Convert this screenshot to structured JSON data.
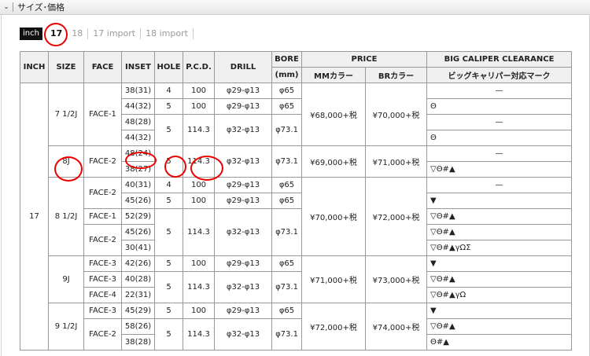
{
  "section": {
    "title": "サイズ･価格"
  },
  "tabs": [
    {
      "label": "inch"
    },
    {
      "label": "17"
    },
    {
      "label": "18"
    },
    {
      "label": "17 import"
    },
    {
      "label": "18 import"
    }
  ],
  "table": {
    "headers": {
      "inch": "INCH",
      "size": "SIZE",
      "face": "FACE",
      "inset": "INSET",
      "hole": "HOLE",
      "pcd": "P.C.D.",
      "drill": "DRILL",
      "bore": "BORE",
      "bore_unit": "(mm)",
      "price": "PRICE",
      "mm_color": "MMカラー",
      "br_color": "BRカラー",
      "clearance": "BIG CALIPER CLEARANCE",
      "clearance_sub": "ビッグキャリパー対応マーク"
    },
    "inch": "17",
    "groups": [
      {
        "size": "7 1/2J",
        "mm": "¥68,000+税",
        "br": "¥70,000+税"
      },
      {
        "size": "8J",
        "mm": "¥69,000+税",
        "br": "¥71,000+税"
      },
      {
        "size": "8 1/2J",
        "mm": "¥70,000+税",
        "br": "¥72,000+税"
      },
      {
        "size": "9J",
        "mm": "¥71,000+税",
        "br": "¥73,000+税"
      },
      {
        "size": "9 1/2J",
        "mm": "¥72,000+税",
        "br": "¥74,000+税"
      }
    ],
    "rows": [
      {
        "inset": "38(31)",
        "clearance": "—"
      },
      {
        "inset": "44(32)",
        "clearance": "Θ"
      },
      {
        "inset": "48(28)",
        "clearance": "—"
      },
      {
        "inset": "44(32)",
        "clearance": "Θ"
      },
      {
        "inset": "48(24)",
        "clearance": "—"
      },
      {
        "inset": "38(27)",
        "clearance": "▽Θ#▲"
      },
      {
        "inset": "40(31)",
        "clearance": "—"
      },
      {
        "inset": "45(26)",
        "clearance": "▼"
      },
      {
        "inset": "52(29)",
        "clearance": "▽Θ#▲"
      },
      {
        "inset": "45(26)",
        "clearance": "▽Θ#▲"
      },
      {
        "inset": "30(41)",
        "clearance": "▽Θ#▲γΩΣ"
      },
      {
        "inset": "42(26)",
        "clearance": "▼"
      },
      {
        "inset": "40(28)",
        "clearance": "▽Θ#▲"
      },
      {
        "inset": "22(31)",
        "clearance": "▽Θ#▲γΩ"
      },
      {
        "inset": "45(29)",
        "clearance": "▼"
      },
      {
        "inset": "58(26)",
        "clearance": "▽Θ#▲"
      },
      {
        "inset": "38(28)",
        "clearance": "Θ#▲"
      }
    ],
    "faces": [
      "FACE-1",
      "FACE-2",
      "FACE-2",
      "FACE-1",
      "FACE-2",
      "FACE-3",
      "FACE-3",
      "FACE-4",
      "FACE-3",
      "FACE-2"
    ],
    "values": {
      "hole4": "4",
      "hole5": "5",
      "pcd100": "100",
      "pcd1143": "114.3",
      "drill_a": "φ29-φ13",
      "drill_b": "φ32-φ13",
      "bore65": "φ65",
      "bore731": "φ73.1"
    }
  }
}
